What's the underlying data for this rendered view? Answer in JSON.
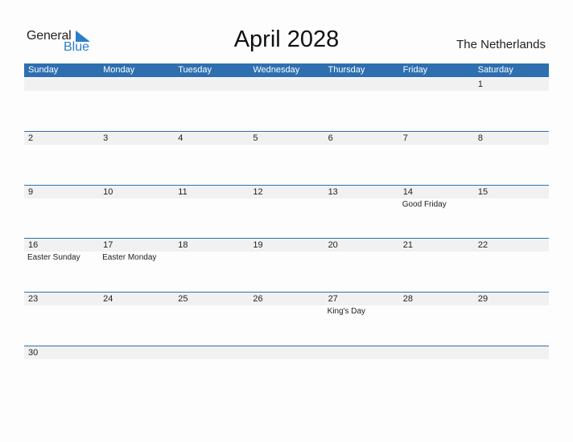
{
  "logo": {
    "text_general": "General",
    "text_blue": "Blue",
    "icon": "triangle-flag-icon",
    "accent": "#2a7fc9"
  },
  "title": "April 2028",
  "country": "The Netherlands",
  "header_color": "#2e6fb0",
  "weekdays": [
    "Sunday",
    "Monday",
    "Tuesday",
    "Wednesday",
    "Thursday",
    "Friday",
    "Saturday"
  ],
  "weeks": [
    [
      {
        "day": ""
      },
      {
        "day": ""
      },
      {
        "day": ""
      },
      {
        "day": ""
      },
      {
        "day": ""
      },
      {
        "day": ""
      },
      {
        "day": "1"
      }
    ],
    [
      {
        "day": "2"
      },
      {
        "day": "3"
      },
      {
        "day": "4"
      },
      {
        "day": "5"
      },
      {
        "day": "6"
      },
      {
        "day": "7"
      },
      {
        "day": "8"
      }
    ],
    [
      {
        "day": "9"
      },
      {
        "day": "10"
      },
      {
        "day": "11"
      },
      {
        "day": "12"
      },
      {
        "day": "13"
      },
      {
        "day": "14",
        "holiday": "Good Friday"
      },
      {
        "day": "15"
      }
    ],
    [
      {
        "day": "16",
        "holiday": "Easter Sunday"
      },
      {
        "day": "17",
        "holiday": "Easter Monday"
      },
      {
        "day": "18"
      },
      {
        "day": "19"
      },
      {
        "day": "20"
      },
      {
        "day": "21"
      },
      {
        "day": "22"
      }
    ],
    [
      {
        "day": "23"
      },
      {
        "day": "24"
      },
      {
        "day": "25"
      },
      {
        "day": "26"
      },
      {
        "day": "27",
        "holiday": "King's Day"
      },
      {
        "day": "28"
      },
      {
        "day": "29"
      }
    ],
    [
      {
        "day": "30"
      },
      {
        "day": ""
      },
      {
        "day": ""
      },
      {
        "day": ""
      },
      {
        "day": ""
      },
      {
        "day": ""
      },
      {
        "day": ""
      }
    ]
  ]
}
